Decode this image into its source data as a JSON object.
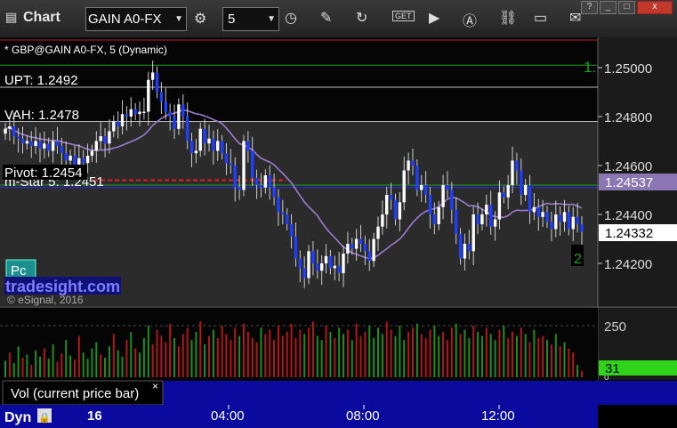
{
  "toolbar": {
    "title": "Chart",
    "symbol": "GAIN A0-FX",
    "interval": "5",
    "window_buttons": [
      "?",
      "_",
      "□",
      "x"
    ]
  },
  "price_pane": {
    "study_title": "* GBP@GAIN A0-FX, 5 (Dynamic)",
    "labels": {
      "upt": "UPT: 1.2492",
      "vah": "VAH: 1.2478",
      "pivot": "Pivot: 1.2454",
      "mstar": "m-Star 5: 1.2451"
    },
    "tag_pc": "Pc",
    "watermark": "tradesight.com",
    "copyright": "© eSignal, 2016",
    "top_right_marker": "1.",
    "bottom_right_marker": "2",
    "last_price": "1.24332",
    "ma_price": "1.24537",
    "colors": {
      "up": "#ffffff",
      "down": "#1f3fff",
      "ma": "#9c7ad0",
      "pivot": "#e02020",
      "level": "#1e9e1e"
    }
  },
  "volume_pane": {
    "label": "Vol (current price bar)",
    "close_glyph": "×",
    "last_volume": "31",
    "colors": {
      "up": "#1e8e1e",
      "down": "#b01818"
    }
  },
  "time_axis": {
    "dyn_label": "Dyn",
    "lock_glyph": "🔒",
    "date_label": "16",
    "times": [
      "04:00",
      "08:00",
      "12:00"
    ]
  },
  "chart_data": [
    {
      "type": "candlestick",
      "title": "* GBP@GAIN A0-FX, 5 (Dynamic)",
      "y_ticks": [
        "1.25000",
        "1.24800",
        "1.24600",
        "1.24400",
        "1.24200"
      ],
      "ylim": [
        1.2406,
        1.2508
      ],
      "x_time_ticks": [
        "04:00",
        "08:00",
        "12:00"
      ],
      "reference_lines": [
        {
          "name": "UPT",
          "value": 1.2492
        },
        {
          "name": "VAH",
          "value": 1.2478
        },
        {
          "name": "Pivot",
          "value": 1.2454
        },
        {
          "name": "m-Star 5",
          "value": 1.2451
        },
        {
          "name": "top level",
          "value": 1.2501
        },
        {
          "name": "lower level",
          "value": 1.2452
        }
      ],
      "last_price": 1.24332,
      "moving_average_last": 1.24537,
      "closes": [
        1.2475,
        1.2476,
        1.2472,
        1.2471,
        1.2469,
        1.247,
        1.2468,
        1.247,
        1.2467,
        1.2469,
        1.2466,
        1.247,
        1.2468,
        1.2465,
        1.2462,
        1.2464,
        1.246,
        1.2463,
        1.2461,
        1.2464,
        1.2466,
        1.247,
        1.2472,
        1.2469,
        1.2474,
        1.2478,
        1.2476,
        1.2481,
        1.248,
        1.2483,
        1.2481,
        1.2482,
        1.2482,
        1.2495,
        1.2498,
        1.249,
        1.2486,
        1.2482,
        1.248,
        1.2475,
        1.2485,
        1.248,
        1.247,
        1.2465,
        1.2466,
        1.2475,
        1.2469,
        1.2471,
        1.2466,
        1.247,
        1.2465,
        1.2461,
        1.246,
        1.2451,
        1.245,
        1.247,
        1.2466,
        1.2455,
        1.2452,
        1.2451,
        1.2456,
        1.2451,
        1.2447,
        1.2441,
        1.244,
        1.2436,
        1.2431,
        1.2422,
        1.2418,
        1.2414,
        1.2425,
        1.242,
        1.2417,
        1.242,
        1.2423,
        1.2418,
        1.2419,
        1.2416,
        1.2424,
        1.2428,
        1.2426,
        1.243,
        1.2428,
        1.2425,
        1.2421,
        1.243,
        1.2435,
        1.244,
        1.2448,
        1.2446,
        1.2438,
        1.2445,
        1.2458,
        1.2462,
        1.246,
        1.245,
        1.2452,
        1.2448,
        1.244,
        1.2436,
        1.2443,
        1.2452,
        1.245,
        1.2442,
        1.2432,
        1.2422,
        1.2428,
        1.2425,
        1.244,
        1.2436,
        1.244,
        1.2444,
        1.2435,
        1.2438,
        1.2449,
        1.2447,
        1.2452,
        1.2462,
        1.2458,
        1.2448,
        1.2452,
        1.2441,
        1.2443,
        1.2439,
        1.2441,
        1.2437,
        1.2434,
        1.244,
        1.2437,
        1.2441,
        1.2434,
        1.2439,
        1.2436,
        1.2433
      ]
    },
    {
      "type": "bar",
      "title": "Vol (current price bar)",
      "y_ticks": [
        "250",
        "0"
      ],
      "ylim": [
        0,
        320
      ],
      "last_value": 31,
      "values": [
        80,
        120,
        70,
        150,
        95,
        110,
        60,
        130,
        100,
        140,
        90,
        160,
        75,
        115,
        180,
        105,
        85,
        200,
        120,
        90,
        140,
        170,
        110,
        95,
        150,
        210,
        130,
        100,
        180,
        220,
        140,
        120,
        190,
        250,
        160,
        230,
        200,
        170,
        260,
        190,
        150,
        210,
        240,
        180,
        220,
        270,
        160,
        200,
        230,
        190,
        250,
        210,
        180,
        240,
        200,
        260,
        220,
        190,
        170,
        240,
        210,
        230,
        180,
        250,
        200,
        220,
        260,
        190,
        230,
        210,
        240,
        270,
        200,
        180,
        250,
        220,
        190,
        240,
        210,
        230,
        180,
        260,
        200,
        220,
        250,
        190,
        240,
        210,
        270,
        230,
        200,
        250,
        180,
        220,
        240,
        260,
        210,
        190,
        230,
        250,
        200,
        220,
        180,
        240,
        260,
        210,
        230,
        190,
        250,
        220,
        200,
        240,
        210,
        180,
        230,
        250,
        190,
        220,
        200,
        240,
        210,
        170,
        230,
        190,
        200,
        180,
        160,
        210,
        150,
        170,
        140,
        120,
        60,
        31
      ],
      "up": [
        1,
        0,
        1,
        1,
        0,
        1,
        0,
        1,
        1,
        0,
        1,
        1,
        0,
        0,
        1,
        1,
        0,
        0,
        1,
        1,
        1,
        1,
        0,
        1,
        1,
        0,
        1,
        1,
        0,
        1,
        0,
        1,
        1,
        1,
        0,
        0,
        0,
        0,
        0,
        1,
        0,
        0,
        0,
        1,
        1,
        0,
        1,
        0,
        1,
        0,
        0,
        0,
        0,
        0,
        1,
        0,
        0,
        0,
        0,
        1,
        0,
        0,
        0,
        0,
        0,
        0,
        0,
        0,
        0,
        1,
        0,
        0,
        1,
        1,
        0,
        1,
        0,
        1,
        1,
        0,
        1,
        0,
        0,
        0,
        1,
        1,
        1,
        1,
        0,
        0,
        1,
        1,
        1,
        0,
        0,
        1,
        0,
        0,
        0,
        1,
        1,
        0,
        0,
        0,
        1,
        0,
        1,
        1,
        0,
        1,
        1,
        0,
        1,
        1,
        0,
        1,
        0,
        0,
        1,
        0,
        1,
        0,
        1,
        0,
        0,
        1,
        0,
        1,
        0,
        1,
        0,
        0,
        1,
        0
      ]
    }
  ]
}
